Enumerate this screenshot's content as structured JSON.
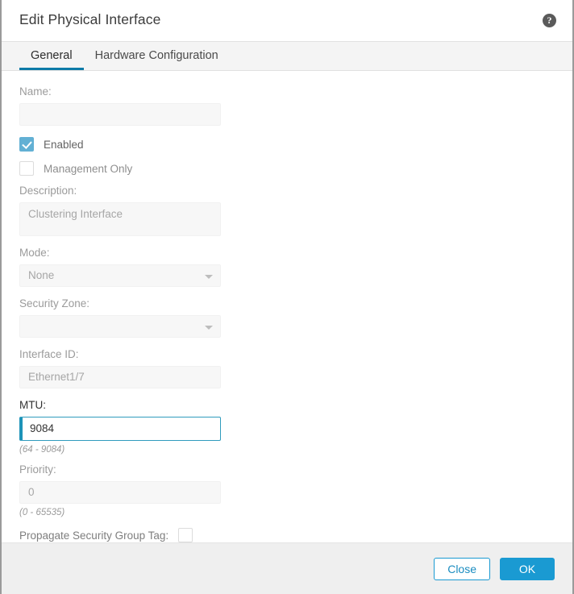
{
  "dialog": {
    "title": "Edit Physical Interface",
    "help_icon": "help-circle-icon",
    "help_label": "?"
  },
  "tabs": [
    {
      "label": "General",
      "active": true
    },
    {
      "label": "Hardware Configuration",
      "active": false
    }
  ],
  "form": {
    "name": {
      "label": "Name:",
      "value": "",
      "placeholder": "",
      "disabled": true
    },
    "enabled_checkbox": {
      "label": "Enabled",
      "checked": true
    },
    "management_only_checkbox": {
      "label": "Management Only",
      "checked": false
    },
    "description": {
      "label": "Description:",
      "value": "Clustering Interface",
      "disabled": true
    },
    "mode": {
      "label": "Mode:",
      "value": "None",
      "disabled": true,
      "caret_icon": "chevron-down-icon"
    },
    "security_zone": {
      "label": "Security Zone:",
      "value": "",
      "disabled": true,
      "caret_icon": "chevron-down-icon"
    },
    "interface_id": {
      "label": "Interface ID:",
      "value": "Ethernet1/7",
      "disabled": true
    },
    "mtu": {
      "label": "MTU:",
      "value": "9084",
      "hint": "(64 - 9084)",
      "disabled": false
    },
    "priority": {
      "label": "Priority:",
      "value": "0",
      "hint": "(0 - 65535)",
      "disabled": true
    },
    "propagate_sgt": {
      "label": "Propagate Security Group Tag:",
      "checked": false
    }
  },
  "footer": {
    "close_label": "Close",
    "ok_label": "OK"
  },
  "colors": {
    "accent_blue": "#1a9ad2",
    "tab_underline": "#0d7aa7",
    "checkbox_checked": "#62b0d4",
    "active_field_border": "#2f9bbd",
    "footer_bg": "#efefef"
  }
}
